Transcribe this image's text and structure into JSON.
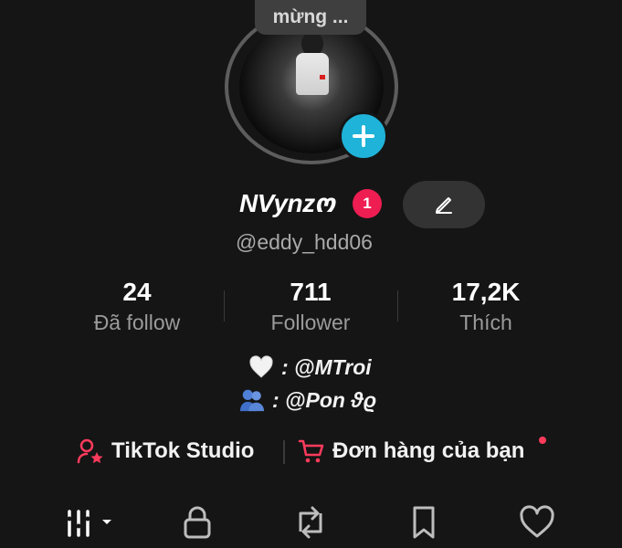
{
  "note": {
    "text": "mừng ..."
  },
  "profile": {
    "display_name": "NVynzო",
    "notification_count": "1",
    "username": "@eddy_hdd06"
  },
  "stats": [
    {
      "value": "24",
      "label": "Đã follow"
    },
    {
      "value": "711",
      "label": "Follower"
    },
    {
      "value": "17,2K",
      "label": "Thích"
    }
  ],
  "bio": {
    "line1": {
      "icon": "white-heart-icon",
      "text": ": @MTroi"
    },
    "line2": {
      "icon": "people-hugging-icon",
      "text": ": @Pon ϑϱ"
    }
  },
  "shortcuts": {
    "studio": {
      "label": "TikTok Studio",
      "icon": "person-star-icon",
      "color": "#ff3b5c"
    },
    "orders": {
      "label": "Đơn hàng của bạn",
      "icon": "cart-icon",
      "color": "#ff3b5c"
    }
  },
  "tabs": [
    {
      "name": "videos",
      "icon": "grid-bars-icon"
    },
    {
      "name": "private",
      "icon": "lock-icon"
    },
    {
      "name": "reposts",
      "icon": "repost-icon"
    },
    {
      "name": "favorites",
      "icon": "bookmark-icon"
    },
    {
      "name": "liked",
      "icon": "heart-icon"
    }
  ],
  "colors": {
    "background": "#151515",
    "accent": "#ee1d52",
    "add_button": "#1fb3d9"
  }
}
